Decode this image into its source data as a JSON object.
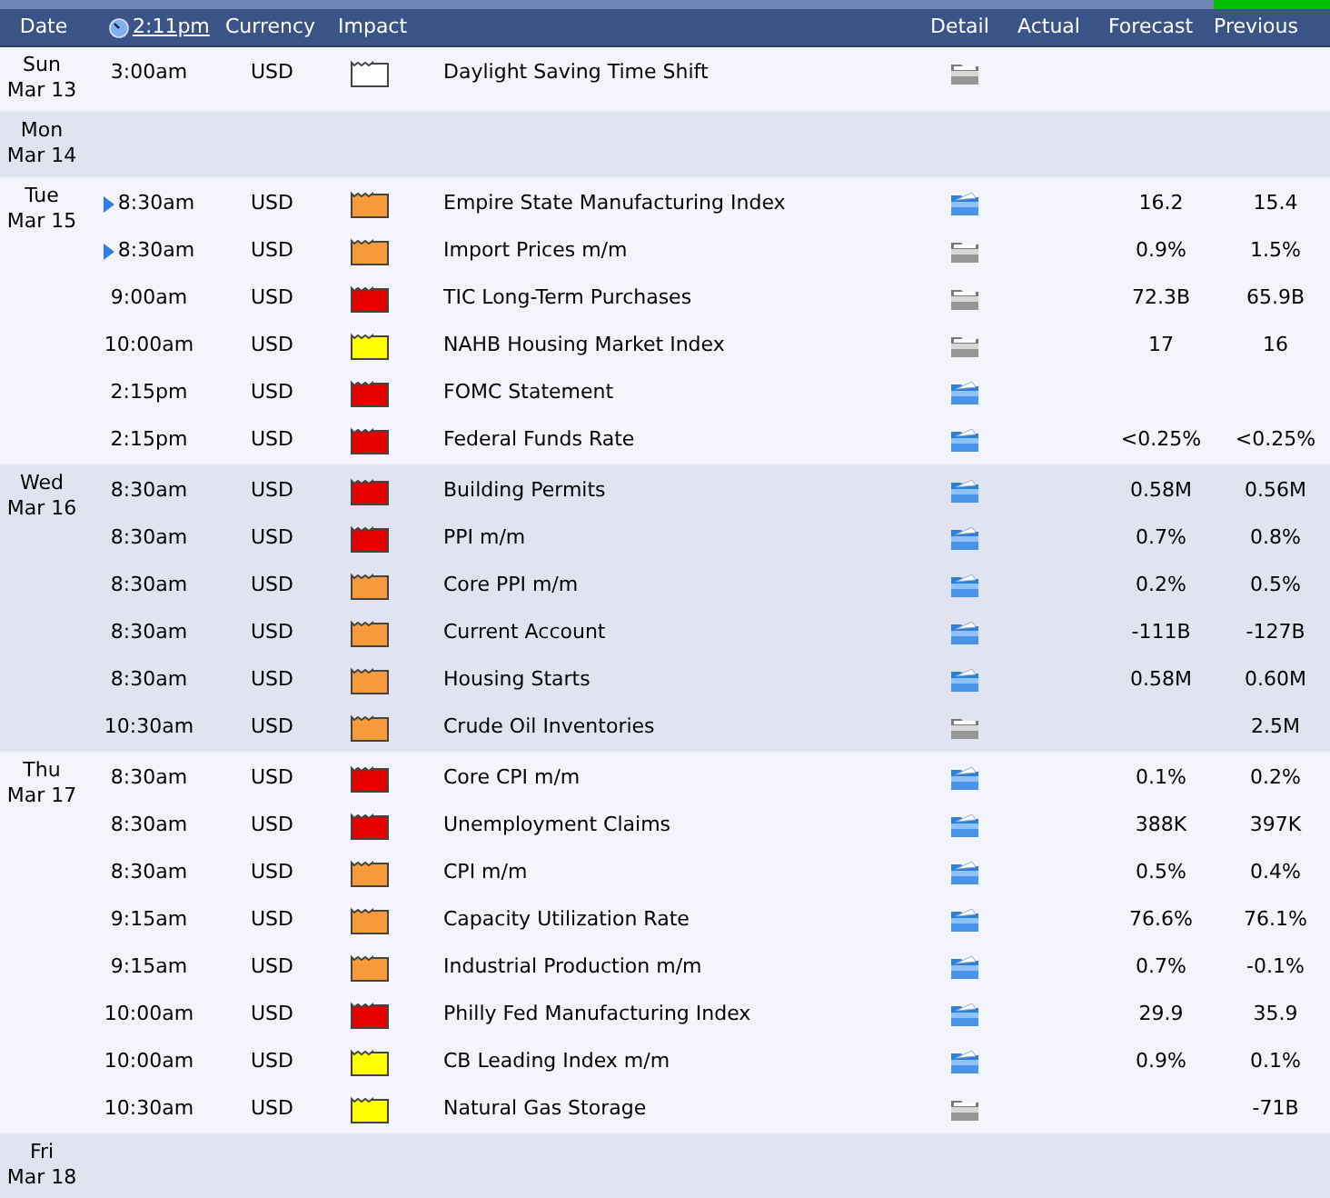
{
  "header": {
    "columns": [
      "Date",
      "2:11pm",
      "Currency",
      "Impact",
      "Detail",
      "Actual",
      "Forecast",
      "Previous"
    ]
  },
  "days": [
    {
      "day": "Sun",
      "date": "Mar 13",
      "events": [
        {
          "time": "3:00am",
          "marked": false,
          "currency": "USD",
          "color": "#ffffff",
          "event": "Daylight Saving Time Shift",
          "detail_active": false
        }
      ]
    },
    {
      "day": "Mon",
      "date": "Mar 14"
    },
    {
      "day": "Tue",
      "date": "Mar 15",
      "events": [
        {
          "time": "8:30am",
          "marked": true,
          "currency": "USD",
          "color": "#f79a3c",
          "event": "Empire State Manufacturing Index",
          "detail_active": true,
          "forecast": "16.2",
          "previous": "15.4"
        },
        {
          "time": "8:30am",
          "marked": true,
          "currency": "USD",
          "color": "#f79a3c",
          "event": "Import Prices m/m",
          "detail_active": false,
          "forecast": "0.9%",
          "previous": "1.5%"
        },
        {
          "time": "9:00am",
          "marked": false,
          "currency": "USD",
          "color": "#e60000",
          "event": "TIC Long-Term Purchases",
          "detail_active": false,
          "forecast": "72.3B",
          "previous": "65.9B"
        },
        {
          "time": "10:00am",
          "marked": false,
          "currency": "USD",
          "color": "#ffff00",
          "event": "NAHB Housing Market Index",
          "detail_active": false,
          "forecast": "17",
          "previous": "16"
        },
        {
          "time": "2:15pm",
          "marked": false,
          "currency": "USD",
          "color": "#e60000",
          "event": "FOMC Statement",
          "detail_active": true
        },
        {
          "time": "2:15pm",
          "marked": false,
          "currency": "USD",
          "color": "#e60000",
          "event": "Federal Funds Rate",
          "detail_active": true,
          "forecast": "<0.25%",
          "previous": "<0.25%"
        }
      ]
    },
    {
      "day": "Wed",
      "date": "Mar 16",
      "events": [
        {
          "time": "8:30am",
          "marked": false,
          "currency": "USD",
          "color": "#e60000",
          "event": "Building Permits",
          "detail_active": true,
          "forecast": "0.58M",
          "previous": "0.56M"
        },
        {
          "time": "8:30am",
          "marked": false,
          "currency": "USD",
          "color": "#e60000",
          "event": "PPI m/m",
          "detail_active": true,
          "forecast": "0.7%",
          "previous": "0.8%"
        },
        {
          "time": "8:30am",
          "marked": false,
          "currency": "USD",
          "color": "#f79a3c",
          "event": "Core PPI m/m",
          "detail_active": true,
          "forecast": "0.2%",
          "previous": "0.5%"
        },
        {
          "time": "8:30am",
          "marked": false,
          "currency": "USD",
          "color": "#f79a3c",
          "event": "Current Account",
          "detail_active": true,
          "forecast": "-111B",
          "previous": "-127B"
        },
        {
          "time": "8:30am",
          "marked": false,
          "currency": "USD",
          "color": "#f79a3c",
          "event": "Housing Starts",
          "detail_active": true,
          "forecast": "0.58M",
          "previous": "0.60M"
        },
        {
          "time": "10:30am",
          "marked": false,
          "currency": "USD",
          "color": "#f79a3c",
          "event": "Crude Oil Inventories",
          "detail_active": false,
          "previous": "2.5M"
        }
      ]
    },
    {
      "day": "Thu",
      "date": "Mar 17",
      "events": [
        {
          "time": "8:30am",
          "marked": false,
          "currency": "USD",
          "color": "#e60000",
          "event": "Core CPI m/m",
          "detail_active": true,
          "forecast": "0.1%",
          "previous": "0.2%"
        },
        {
          "time": "8:30am",
          "marked": false,
          "currency": "USD",
          "color": "#e60000",
          "event": "Unemployment Claims",
          "detail_active": true,
          "forecast": "388K",
          "previous": "397K"
        },
        {
          "time": "8:30am",
          "marked": false,
          "currency": "USD",
          "color": "#f79a3c",
          "event": "CPI m/m",
          "detail_active": true,
          "forecast": "0.5%",
          "previous": "0.4%"
        },
        {
          "time": "9:15am",
          "marked": false,
          "currency": "USD",
          "color": "#f79a3c",
          "event": "Capacity Utilization Rate",
          "detail_active": true,
          "forecast": "76.6%",
          "previous": "76.1%"
        },
        {
          "time": "9:15am",
          "marked": false,
          "currency": "USD",
          "color": "#f79a3c",
          "event": "Industrial Production m/m",
          "detail_active": true,
          "forecast": "0.7%",
          "previous": "-0.1%"
        },
        {
          "time": "10:00am",
          "marked": false,
          "currency": "USD",
          "color": "#e60000",
          "event": "Philly Fed Manufacturing Index",
          "detail_active": true,
          "forecast": "29.9",
          "previous": "35.9"
        },
        {
          "time": "10:00am",
          "marked": false,
          "currency": "USD",
          "color": "#ffff00",
          "event": "CB Leading Index m/m",
          "detail_active": true,
          "forecast": "0.9%",
          "previous": "0.1%"
        },
        {
          "time": "10:30am",
          "marked": false,
          "currency": "USD",
          "color": "#ffff00",
          "event": "Natural Gas Storage",
          "detail_active": false,
          "previous": "-71B"
        }
      ]
    },
    {
      "day": "Fri",
      "date": "Mar 18"
    }
  ]
}
